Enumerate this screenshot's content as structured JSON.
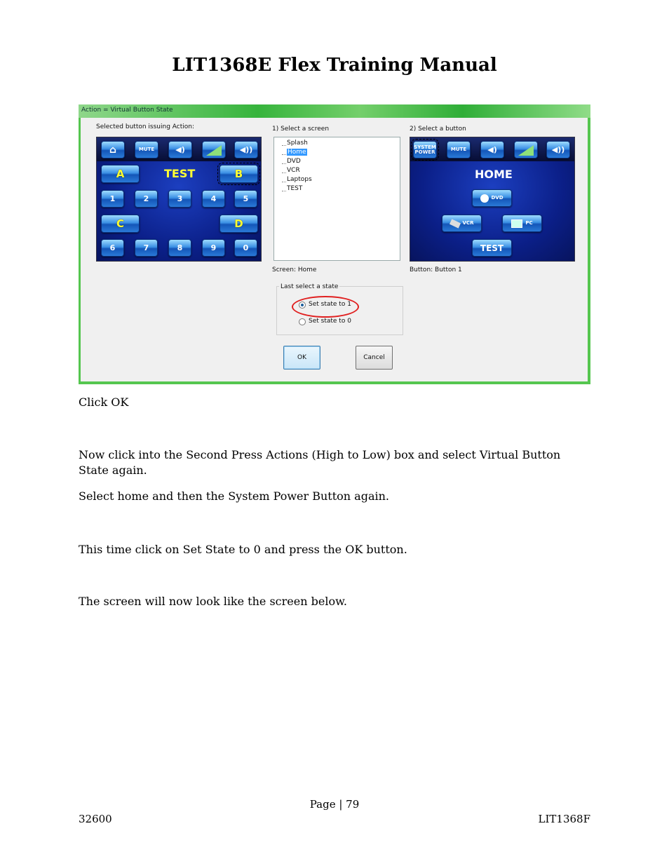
{
  "header": {
    "title": "LIT1368E Flex Training Manual"
  },
  "dialog": {
    "title": "Action = Virtual Button State",
    "left_label": "Selected button issuing Action:",
    "tree_label": "1) Select a screen",
    "right_label": "2) Select a button",
    "tree_items": [
      "Splash",
      "Home",
      "DVD",
      "VCR",
      "Laptops",
      "TEST"
    ],
    "screen_status": "Screen: Home",
    "button_status": "Button: Button 1",
    "group_label": "Last select a state",
    "radio_1": "Set state to 1",
    "radio_2": "Set state to 0",
    "ok": "OK",
    "cancel": "Cancel",
    "left_panel": {
      "title": "TEST",
      "mute": "MUTE",
      "letters": [
        "A",
        "B",
        "C",
        "D"
      ],
      "row1": [
        "1",
        "2",
        "3",
        "4",
        "5"
      ],
      "row2": [
        "6",
        "7",
        "8",
        "9",
        "0"
      ]
    },
    "right_panel": {
      "title": "HOME",
      "system_power": "SYSTEM POWER",
      "mute": "MUTE",
      "dvd": "DVD",
      "vcr": "VCR",
      "pc": "PC",
      "test": "TEST"
    }
  },
  "body": {
    "p1": "Click OK",
    "p2": "Now click into the Second Press Actions (High to Low) box and select Virtual Button State again.",
    "p3": "Select home and then the System Power Button again.",
    "p4": "This time click on Set State to 0 and press the OK button.",
    "p5": "The screen will now look like the screen below."
  },
  "footer": {
    "page": "Page | 79",
    "left": "32600",
    "right": "LIT1368F"
  }
}
